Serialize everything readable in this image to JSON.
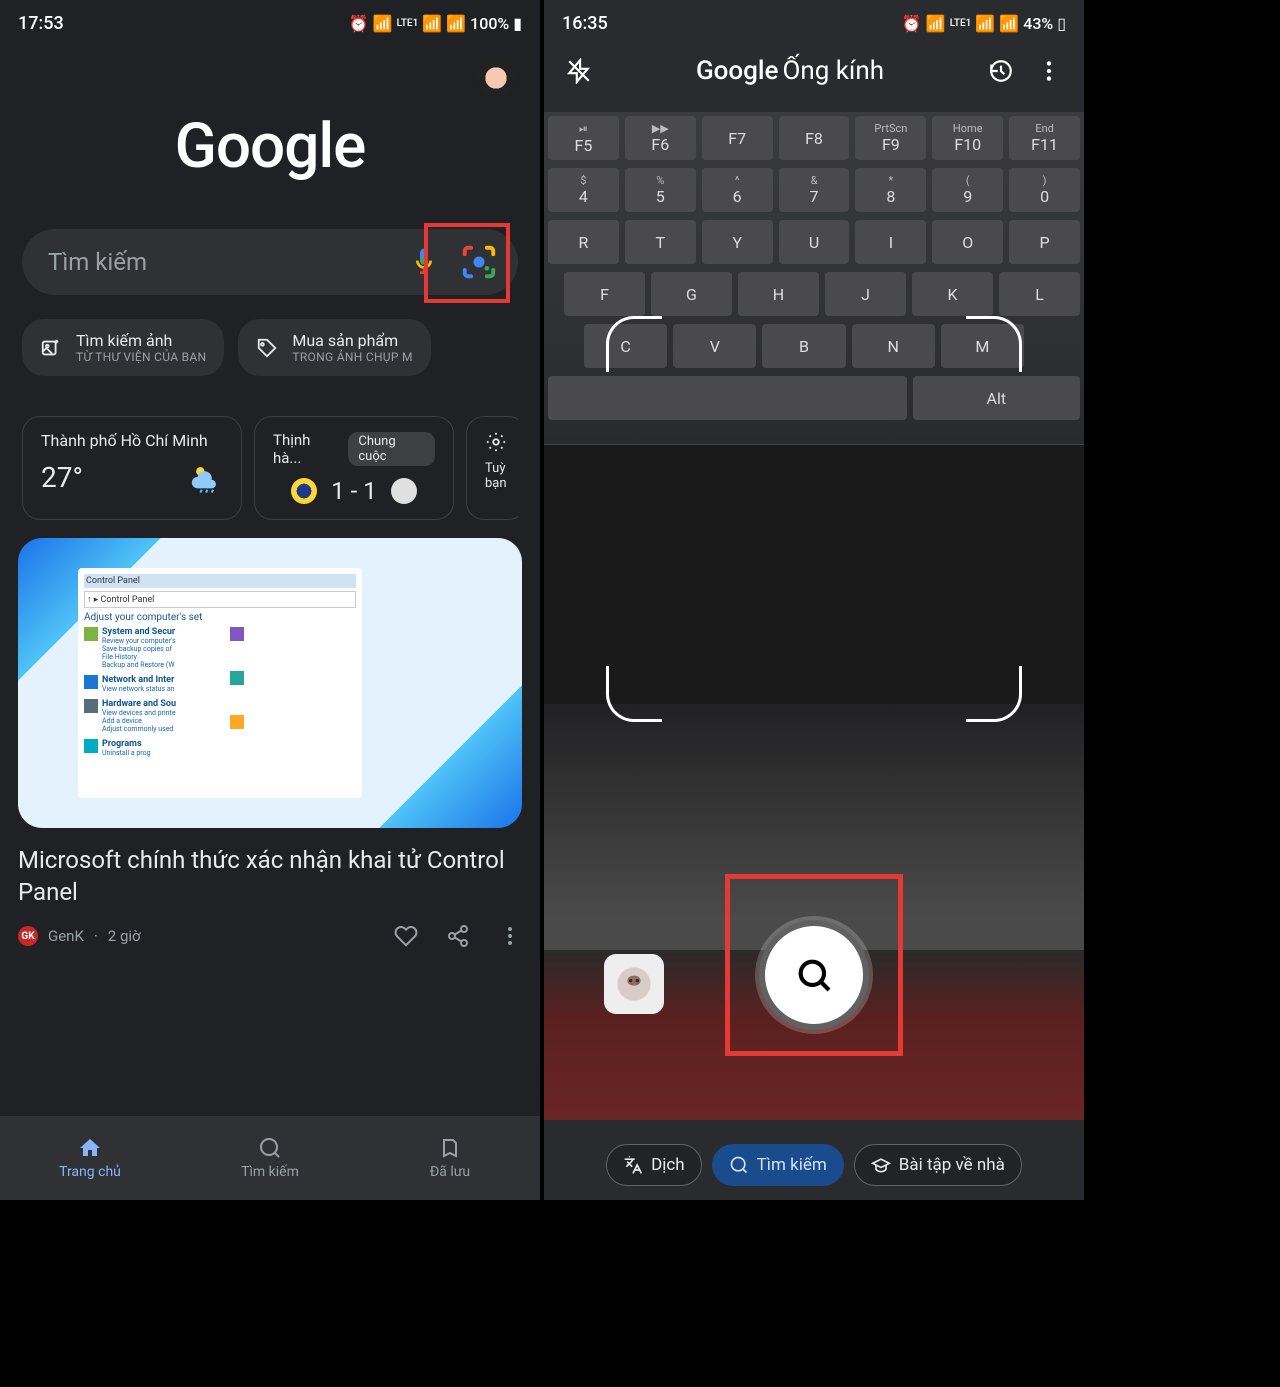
{
  "left": {
    "status": {
      "time": "17:53",
      "battery": "100%",
      "net": "LTE1"
    },
    "logo": "Google",
    "search": {
      "placeholder": "Tìm kiếm"
    },
    "chips": [
      {
        "title": "Tìm kiếm ảnh",
        "sub": "TỪ THƯ VIỆN CỦA BẠN"
      },
      {
        "title": "Mua sản phẩm",
        "sub": "TRONG ẢNH CHỤP M"
      }
    ],
    "weather": {
      "city": "Thành phố Hồ Chí Minh",
      "temp": "27°"
    },
    "score": {
      "league": "Thịnh hà...",
      "status": "Chung cuộc",
      "result": "1 - 1"
    },
    "settings": {
      "label": "Tuỳ bạn"
    },
    "news": {
      "img_title": "Control Panel",
      "img_breadcrumb": "Control Panel",
      "img_heading": "Adjust your computer's set",
      "img_cat1": "System and Secur",
      "img_cat1a": "Review your computer's",
      "img_cat1b": "Save backup copies of",
      "img_cat1c": "File History",
      "img_cat1d": "Backup and Restore (W",
      "img_cat2": "Network and Inter",
      "img_cat2a": "View network status an",
      "img_cat3": "Hardware and Sou",
      "img_cat3a": "View devices and printe",
      "img_cat3b": "Add a device",
      "img_cat3c": "Adjust commonly used",
      "img_cat4": "Programs",
      "img_cat4a": "Uninstall a prog",
      "title": "Microsoft chính thức xác nhận khai tử Control Panel",
      "source": "GenK",
      "time": "2 giờ"
    },
    "nav": [
      {
        "label": "Trang chủ"
      },
      {
        "label": "Tìm kiếm"
      },
      {
        "label": "Đã lưu"
      }
    ]
  },
  "right": {
    "status": {
      "time": "16:35",
      "battery": "43%",
      "net": "LTE1"
    },
    "title_brand": "Google",
    "title_app": "Ống kính",
    "keyboard": {
      "fn_row": [
        [
          "F5",
          "⏯"
        ],
        [
          "F6",
          "▶▶"
        ],
        [
          "F7",
          ""
        ],
        [
          "F8",
          ""
        ],
        [
          "F9",
          "PrtScn"
        ],
        [
          "F10",
          "Home"
        ],
        [
          "F11",
          "End"
        ]
      ],
      "num_row": [
        [
          "4",
          "$"
        ],
        [
          "5",
          "%"
        ],
        [
          "6",
          "^"
        ],
        [
          "7",
          "&"
        ],
        [
          "8",
          "*"
        ],
        [
          "9",
          "("
        ],
        [
          "0",
          ")"
        ]
      ],
      "row1": [
        "R",
        "T",
        "Y",
        "U",
        "I",
        "O",
        "P"
      ],
      "row2": [
        "F",
        "G",
        "H",
        "J",
        "K",
        "L"
      ],
      "row3": [
        "C",
        "V",
        "B",
        "N",
        "M"
      ],
      "alt": "Alt"
    },
    "modes": [
      {
        "label": "Dịch"
      },
      {
        "label": "Tìm kiếm"
      },
      {
        "label": "Bài tập về nhà"
      }
    ]
  }
}
